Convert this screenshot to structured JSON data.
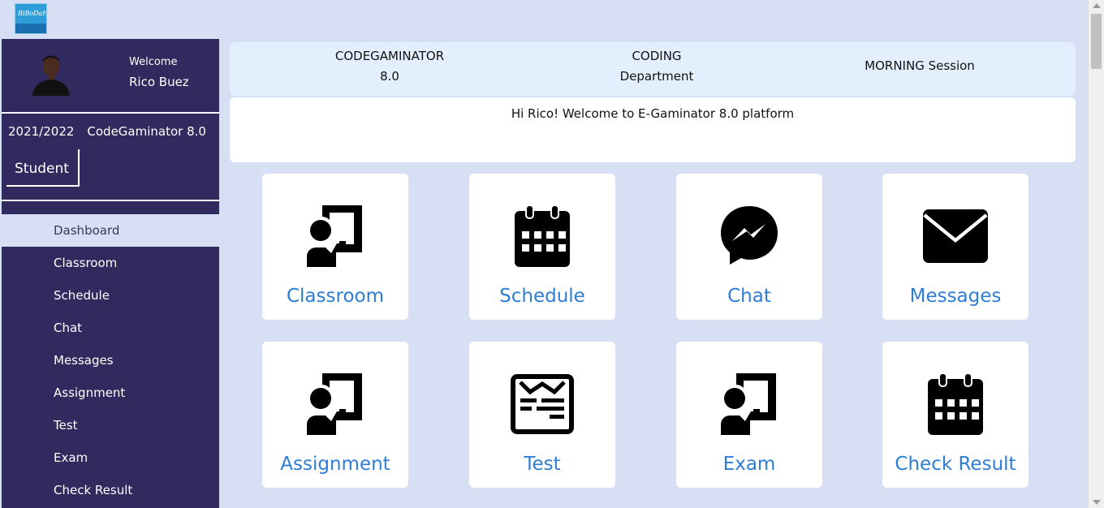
{
  "header": {
    "logo_text": "BiBoDaH"
  },
  "sidebar": {
    "welcome_label": "Welcome",
    "user_name": "Rico Buez",
    "session_year": "2021/2022",
    "program": "CodeGaminator 8.0",
    "role": "Student",
    "items": [
      {
        "label": "Dashboard",
        "active": true
      },
      {
        "label": "Classroom"
      },
      {
        "label": "Schedule"
      },
      {
        "label": "Chat"
      },
      {
        "label": "Messages"
      },
      {
        "label": "Assignment"
      },
      {
        "label": "Test"
      },
      {
        "label": "Exam"
      },
      {
        "label": "Check Result"
      }
    ]
  },
  "info_bar": {
    "program_line1": "CODEGAMINATOR",
    "program_line2": "8.0",
    "dept_line1": "CODING",
    "dept_line2": "Department",
    "session": "MORNING Session"
  },
  "greeting": "Hi Rico! Welcome to E-Gaminator 8.0 platform",
  "cards": [
    {
      "label": "Classroom",
      "icon": "chalkboard-teacher-icon"
    },
    {
      "label": "Schedule",
      "icon": "calendar-icon"
    },
    {
      "label": "Chat",
      "icon": "messenger-icon"
    },
    {
      "label": "Messages",
      "icon": "envelope-icon"
    },
    {
      "label": "Assignment",
      "icon": "chalkboard-teacher-icon"
    },
    {
      "label": "Test",
      "icon": "newspaper-icon"
    },
    {
      "label": "Exam",
      "icon": "chalkboard-teacher-icon"
    },
    {
      "label": "Check Result",
      "icon": "calendar-icon"
    }
  ],
  "colors": {
    "sidebar_bg": "#312a5f",
    "page_bg": "#d7dff4",
    "accent": "#2d7dd6",
    "info_bg": "#e3effc"
  }
}
